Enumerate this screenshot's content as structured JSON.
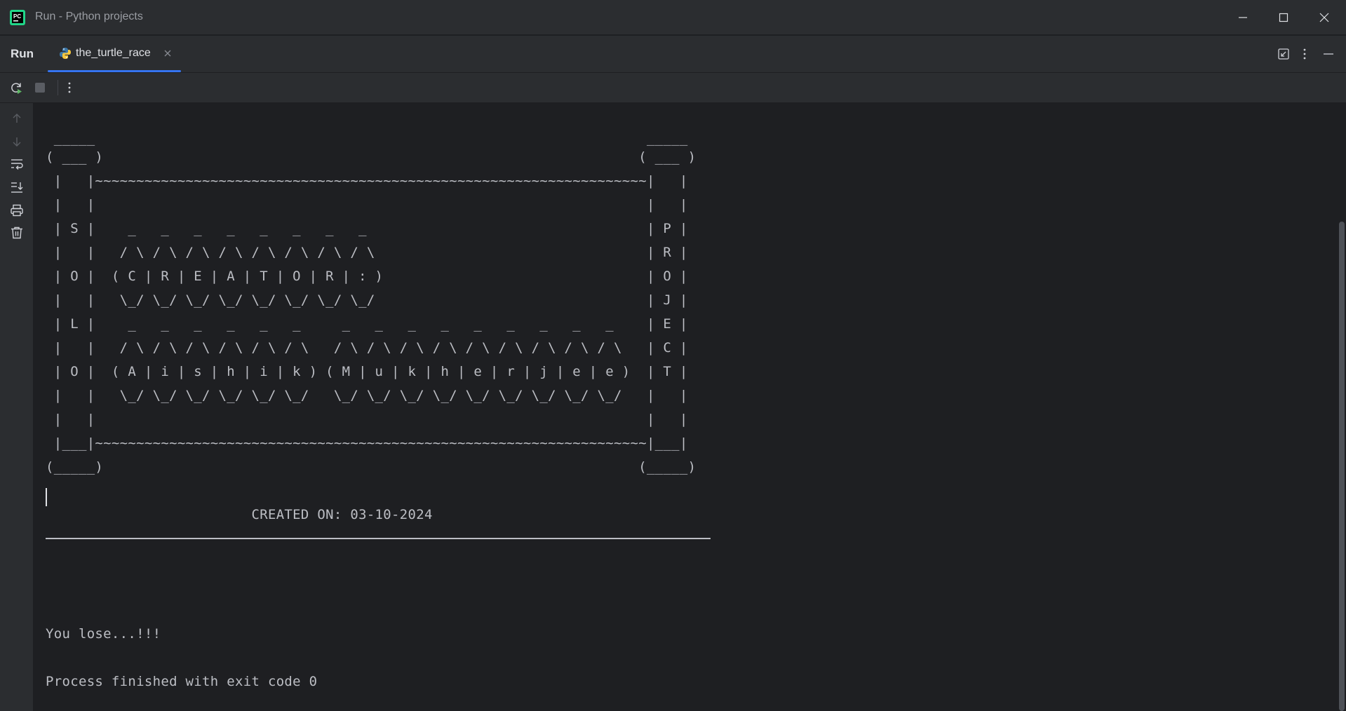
{
  "window": {
    "title": "Run - Python projects",
    "minimize_icon": "minimize-icon",
    "maximize_icon": "maximize-icon",
    "close_icon": "close-icon"
  },
  "tabbar": {
    "run_label": "Run",
    "tab": {
      "label": "the_turtle_race",
      "icon": "python-icon"
    },
    "right_icons": [
      "restore-layout-icon",
      "more-vertical-icon",
      "hide-icon"
    ]
  },
  "toolbar": {
    "items": [
      "rerun-icon",
      "stop-icon",
      "more-vertical-icon"
    ]
  },
  "gutter": {
    "items": [
      "arrow-up-icon",
      "arrow-down-icon",
      "soft-wrap-icon",
      "scroll-to-end-icon",
      "print-icon",
      "trash-icon"
    ]
  },
  "console": {
    "lines": [
      " _____                                                                   _____",
      "( ___ )                                                                 ( ___ )",
      " |   |~~~~~~~~~~~~~~~~~~~~~~~~~~~~~~~~~~~~~~~~~~~~~~~~~~~~~~~~~~~~~~~~~~~|   |",
      " |   |                                                                   |   |",
      " | S |    _   _   _   _   _   _   _   _                                  | P |",
      " |   |   / \\ / \\ / \\ / \\ / \\ / \\ / \\ / \\                                 | R |",
      " | O |  ( C | R | E | A | T | O | R | : )                                | O |",
      " |   |   \\_/ \\_/ \\_/ \\_/ \\_/ \\_/ \\_/ \\_/                                 | J |",
      " | L |    _   _   _   _   _   _     _   _   _   _   _   _   _   _   _    | E |",
      " |   |   / \\ / \\ / \\ / \\ / \\ / \\   / \\ / \\ / \\ / \\ / \\ / \\ / \\ / \\ / \\   | C |",
      " | O |  ( A | i | s | h | i | k ) ( M | u | k | h | e | r | j | e | e )  | T |",
      " |   |   \\_/ \\_/ \\_/ \\_/ \\_/ \\_/   \\_/ \\_/ \\_/ \\_/ \\_/ \\_/ \\_/ \\_/ \\_/   |   |",
      " |   |                                                                   |   |",
      " |___|~~~~~~~~~~~~~~~~~~~~~~~~~~~~~~~~~~~~~~~~~~~~~~~~~~~~~~~~~~~~~~~~~~~|___|",
      "(_____)                                                                 (_____)",
      "",
      "                         CREATED ON: 03-10-2024",
      "",
      "",
      "",
      "",
      "You lose...!!!",
      "",
      "Process finished with exit code 0"
    ]
  }
}
